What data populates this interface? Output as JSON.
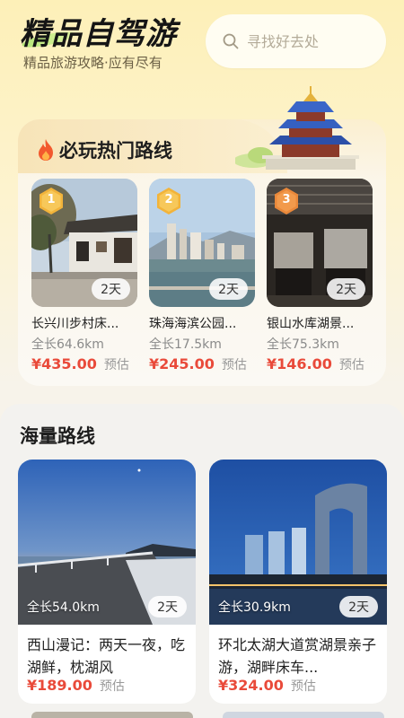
{
  "header": {
    "title": "精品自驾游",
    "subtitle": "精品旅游攻略·应有尽有",
    "search_placeholder": "寻找好去处"
  },
  "hot_section": {
    "title": "必玩热门路线",
    "items": [
      {
        "rank": "1",
        "days": "2天",
        "name": "长兴川步村床...",
        "length": "全长64.6km",
        "price": "¥435.00",
        "price_note": "预估"
      },
      {
        "rank": "2",
        "days": "2天",
        "name": "珠海海滨公园...",
        "length": "全长17.5km",
        "price": "¥245.00",
        "price_note": "预估"
      },
      {
        "rank": "3",
        "days": "2天",
        "name": "银山水库湖景...",
        "length": "全长75.3km",
        "price": "¥146.00",
        "price_note": "预估"
      }
    ]
  },
  "mass_section": {
    "title": "海量路线",
    "routes": [
      {
        "length": "全长54.0km",
        "days": "2天",
        "title": "西山漫记：两天一夜，吃湖鲜，枕湖风",
        "price": "¥189.00",
        "price_note": "预估"
      },
      {
        "length": "全长30.9km",
        "days": "2天",
        "title": "环北太湖大道赏湖景亲子游，湖畔床车...",
        "price": "¥324.00",
        "price_note": "预估"
      }
    ]
  },
  "colors": {
    "price": "#e94a3a",
    "rank_badge": "#f0b53a",
    "background_top": "#fdf0b8"
  }
}
